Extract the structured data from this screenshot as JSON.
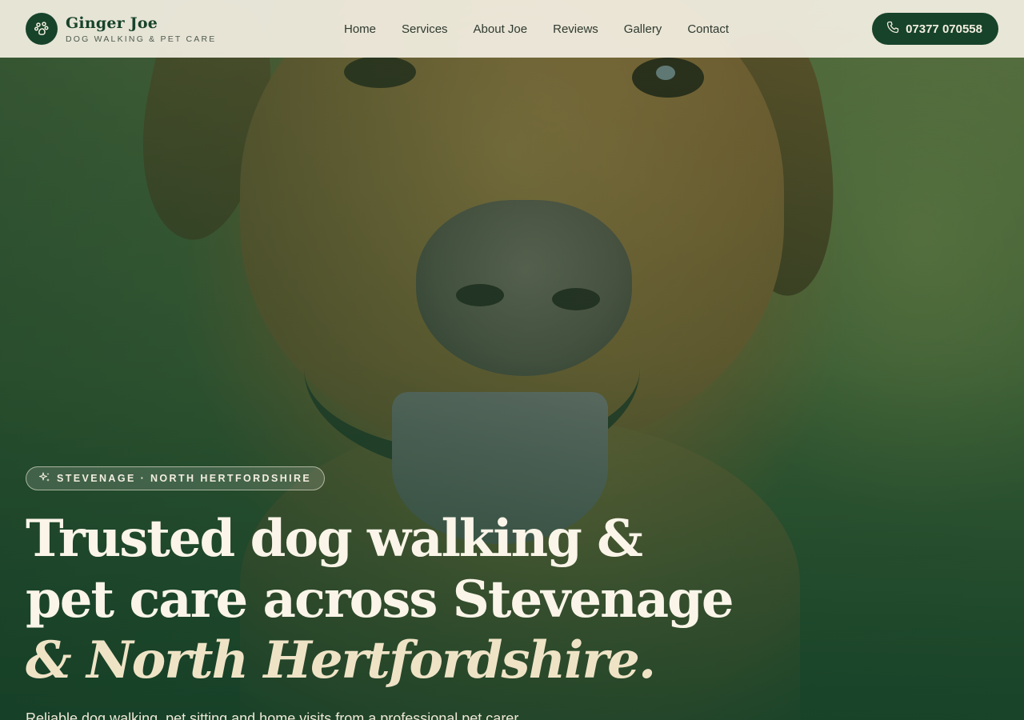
{
  "brand": {
    "name": "Ginger Joe",
    "tagline": "DOG WALKING & PET CARE",
    "logo_icon": "paw-icon"
  },
  "nav": {
    "items": [
      "Home",
      "Services",
      "About Joe",
      "Reviews",
      "Gallery",
      "Contact"
    ]
  },
  "call_button": {
    "icon": "phone-icon",
    "label": "07377 070558"
  },
  "hero": {
    "badge_icon": "sparkle-icon",
    "badge": "STEVENAGE · NORTH HERTFORDSHIRE",
    "headline_line1": "Trusted dog walking &",
    "headline_line2": "pet care across Stevenage",
    "headline_accent": "& North Hertfordshire.",
    "subtext": "Reliable dog walking, pet sitting and home visits from a professional pet carer"
  },
  "colors": {
    "brand_green": "#17432b",
    "header_bg": "#f3efe2",
    "cream_text": "#faf5e8"
  }
}
